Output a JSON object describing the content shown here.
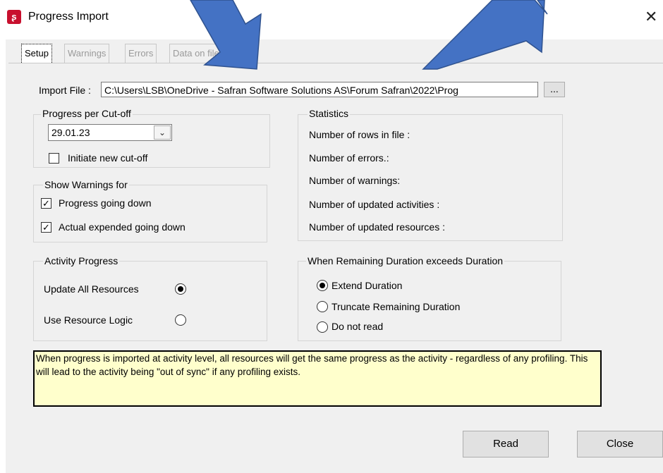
{
  "window": {
    "title": "Progress Import",
    "close_glyph": "✕",
    "app_icon": "safran-logo-icon"
  },
  "tabs": [
    {
      "label": "Setup",
      "active": true
    },
    {
      "label": "Warnings",
      "active": false
    },
    {
      "label": "Errors",
      "active": false
    },
    {
      "label": "Data on file",
      "active": false
    }
  ],
  "import": {
    "label": "Import File :",
    "value": "C:\\Users\\LSB\\OneDrive - Safran Software Solutions AS\\Forum Safran\\2022\\Prog",
    "browse_label": "..."
  },
  "cutoff": {
    "title": "Progress per Cut-off",
    "date": "29.01.23",
    "initiate_label": "Initiate new cut-off",
    "initiate_checked": false
  },
  "warnings": {
    "title": "Show Warnings for",
    "items": [
      {
        "label": "Progress going down",
        "checked": true
      },
      {
        "label": "Actual expended going down",
        "checked": true
      }
    ]
  },
  "statistics": {
    "title": "Statistics",
    "rows": [
      "Number of rows in file :",
      "Number of errors.:",
      "Number of warnings:",
      "Number of updated activities :",
      "Number of updated resources :"
    ]
  },
  "activity_progress": {
    "title": "Activity Progress",
    "options": [
      {
        "label": "Update All Resources",
        "selected": true
      },
      {
        "label": "Use Resource Logic",
        "selected": false
      }
    ]
  },
  "remaining": {
    "title": "When Remaining Duration exceeds  Duration",
    "options": [
      {
        "label": "Extend Duration",
        "selected": true
      },
      {
        "label": "Truncate Remaining Duration",
        "selected": false
      },
      {
        "label": "Do not read",
        "selected": false
      }
    ]
  },
  "info": {
    "text": "When progress is imported at activity level, all resources will get the same progress as the activity - regardless of any profiling. This will lead to the activity being \"out of sync\" if any profiling exists."
  },
  "buttons": {
    "read": "Read",
    "close": "Close"
  },
  "colors": {
    "arrow": "#4472c4",
    "arrow_border": "#2f528f",
    "info_bg": "#ffffcc",
    "app_icon": "#c8102e"
  }
}
